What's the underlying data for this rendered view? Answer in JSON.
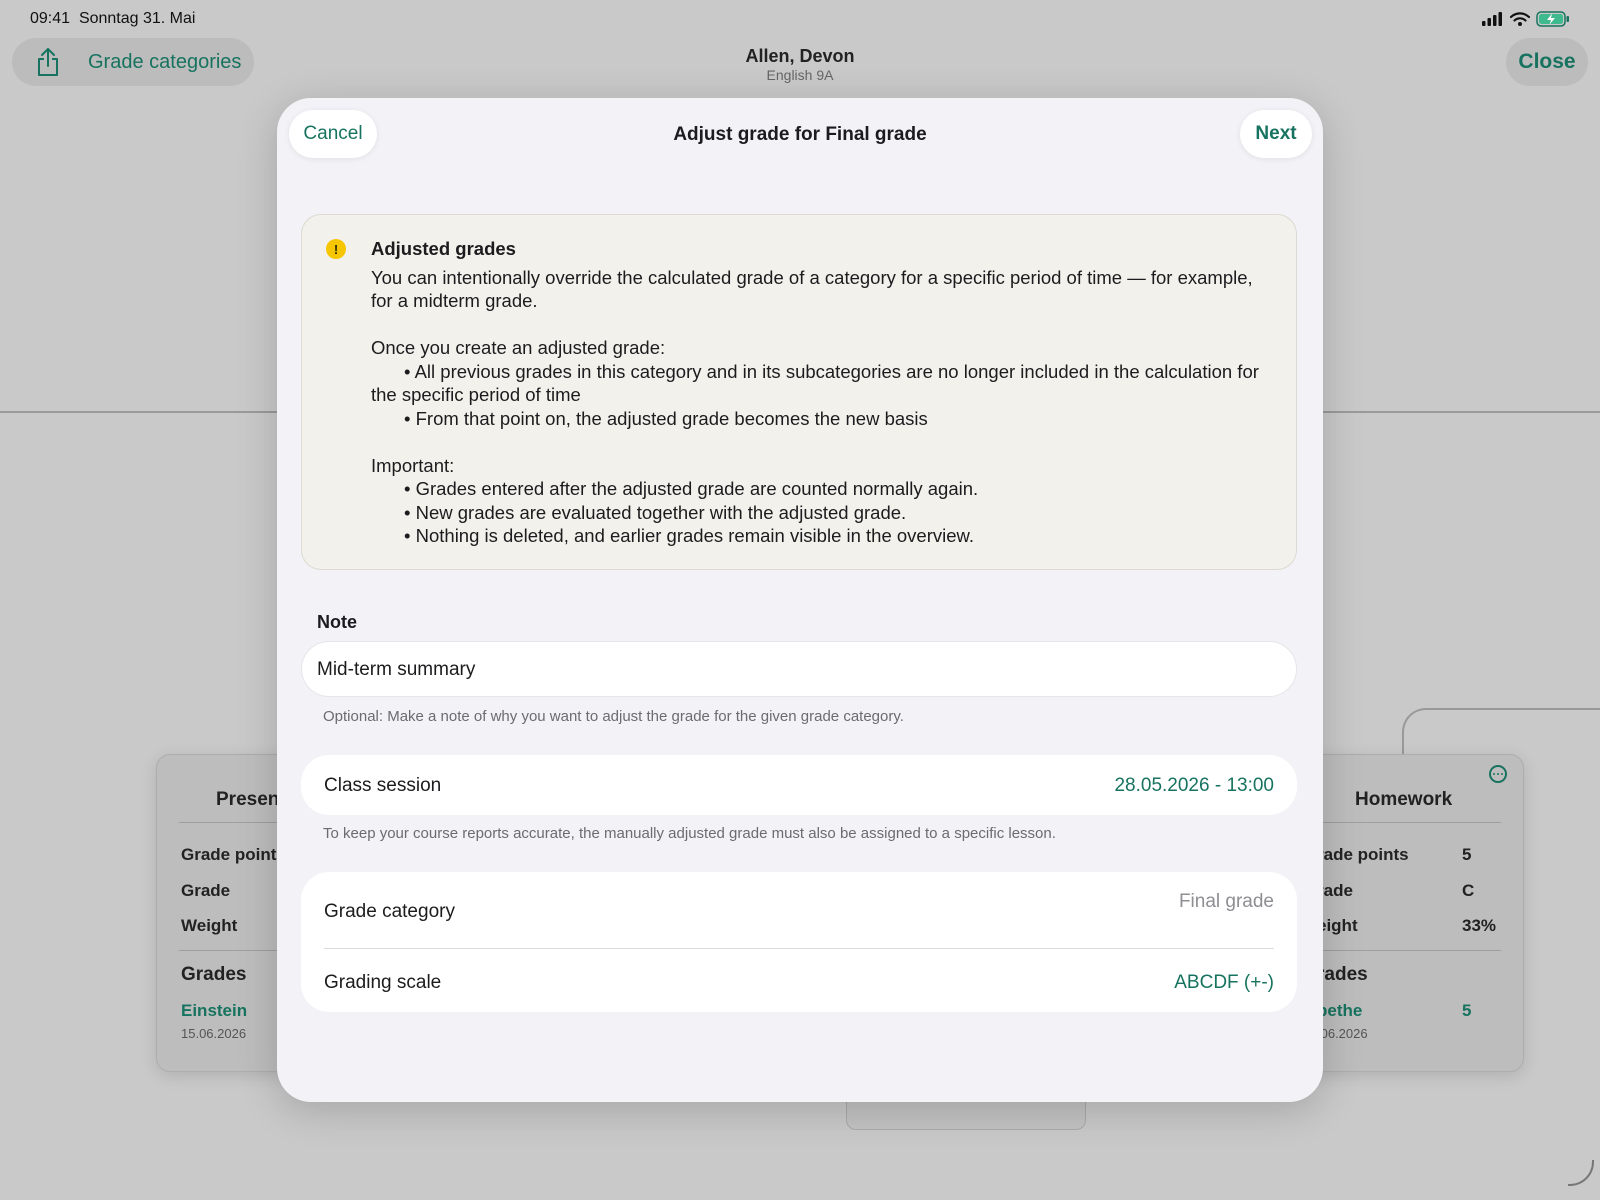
{
  "status": {
    "time": "09:41",
    "date": "Sonntag 31. Mai",
    "icons": [
      "cellular-icon",
      "wifi-icon",
      "battery-charging-icon"
    ]
  },
  "nav": {
    "share_icon": "share-icon",
    "grade_categories": "Grade categories",
    "close": "Close",
    "student_name": "Allen, Devon",
    "course": "English 9A"
  },
  "background_cards": {
    "left": {
      "title": "Presen",
      "rows": [
        {
          "label": "Grade point"
        },
        {
          "label": "Grade"
        },
        {
          "label": "Weight"
        }
      ],
      "grades_heading": "Grades",
      "grade_link": "Einstein",
      "grade_date": "15.06.2026"
    },
    "right": {
      "title": "Homework",
      "rows": [
        {
          "label": "rade points",
          "value": "5"
        },
        {
          "label": "rade",
          "value": "C"
        },
        {
          "label": "eight",
          "value": "33%"
        }
      ],
      "grades_heading": "rades",
      "grade_link": "pethe",
      "grade_value": "5",
      "grade_date": ".06.2026"
    }
  },
  "modal": {
    "cancel": "Cancel",
    "title": "Adjust grade for Final grade",
    "next": "Next",
    "info": {
      "title": "Adjusted grades",
      "intro": "You can intentionally override the calculated grade of a category for a specific period of time — for example, for a midterm grade.",
      "once_heading": "Once you create an adjusted grade:",
      "once_bullets": [
        "• All previous grades in this category and in its subcategories are no longer included in the calculation for the specific period of time",
        "• From that point on, the adjusted grade becomes the new basis"
      ],
      "important_heading": "Important:",
      "important_bullets": [
        "• Grades entered after the adjusted grade are counted normally again.",
        "• New grades are evaluated together with the adjusted grade.",
        "• Nothing is deleted, and earlier grades remain visible in the overview."
      ]
    },
    "note": {
      "label": "Note",
      "value": "Mid-term summary",
      "hint": "Optional: Make a note of why you want to adjust the grade for the given grade category."
    },
    "class_session": {
      "label": "Class session",
      "value": "28.05.2026 - 13:00",
      "hint": "To keep your course reports accurate, the manually adjusted grade must also be assigned to a specific lesson."
    },
    "grade_category": {
      "label": "Grade category",
      "value": "Final grade"
    },
    "grading_scale": {
      "label": "Grading scale",
      "value": "ABCDF (+-)"
    }
  },
  "colors": {
    "accent": "#17735f",
    "warning": "#f6c600",
    "sheet_background": "#f2f2f7",
    "info_background": "#f3f1ec"
  }
}
